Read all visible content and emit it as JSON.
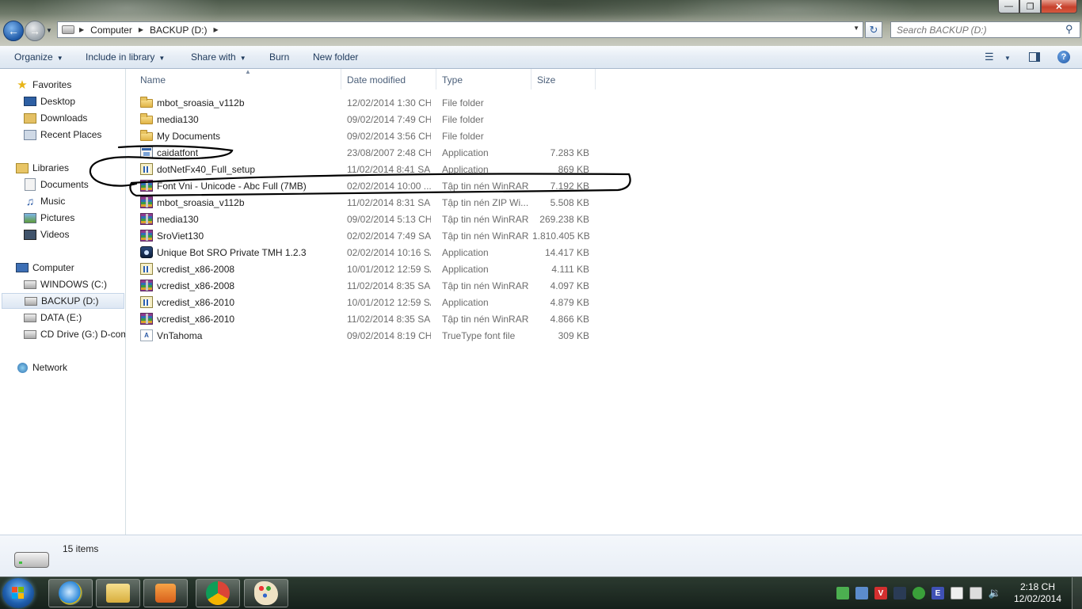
{
  "window": {
    "minimize_glyph": "—",
    "maximize_glyph": "❐",
    "close_glyph": "✕"
  },
  "address": {
    "crumbs": [
      "Computer",
      "BACKUP (D:)"
    ],
    "search_placeholder": "Search BACKUP (D:)"
  },
  "toolbar": {
    "organize": "Organize",
    "include_in_library": "Include in library",
    "share_with": "Share with",
    "burn": "Burn",
    "new_folder": "New folder"
  },
  "nav": {
    "favorites": "Favorites",
    "desktop": "Desktop",
    "downloads": "Downloads",
    "recent_places": "Recent Places",
    "libraries": "Libraries",
    "documents": "Documents",
    "music": "Music",
    "pictures": "Pictures",
    "videos": "Videos",
    "computer": "Computer",
    "windows_c": "WINDOWS (C:)",
    "backup_d": "BACKUP (D:)",
    "data_e": "DATA (E:)",
    "cd_drive": "CD Drive (G:) D-com",
    "network": "Network"
  },
  "columns": {
    "name": "Name",
    "date_modified": "Date modified",
    "type": "Type",
    "size": "Size"
  },
  "files": [
    {
      "name": "mbot_sroasia_v112b",
      "date": "12/02/2014 1:30 CH",
      "type": "File folder",
      "size": "",
      "icon": "folder-icon"
    },
    {
      "name": "media130",
      "date": "09/02/2014 7:49 CH",
      "type": "File folder",
      "size": "",
      "icon": "folder-icon"
    },
    {
      "name": "My Documents",
      "date": "09/02/2014 3:56 CH",
      "type": "File folder",
      "size": "",
      "icon": "folder-icon"
    },
    {
      "name": "caidatfont",
      "date": "23/08/2007 2:48 CH",
      "type": "Application",
      "size": "7.283 KB",
      "icon": "application-icon"
    },
    {
      "name": "dotNetFx40_Full_setup",
      "date": "11/02/2014 8:41 SA",
      "type": "Application",
      "size": "869 KB",
      "icon": "setup-icon"
    },
    {
      "name": "Font Vni - Unicode - Abc Full (7MB)",
      "date": "02/02/2014 10:00 ...",
      "type": "Tập tin nén WinRAR",
      "size": "7.192 KB",
      "icon": "winrar-archive-icon"
    },
    {
      "name": "mbot_sroasia_v112b",
      "date": "11/02/2014 8:31 SA",
      "type": "Tập tin nén ZIP Wi...",
      "size": "5.508 KB",
      "icon": "winrar-archive-icon"
    },
    {
      "name": "media130",
      "date": "09/02/2014 5:13 CH",
      "type": "Tập tin nén WinRAR",
      "size": "269.238 KB",
      "icon": "winrar-archive-icon"
    },
    {
      "name": "SroViet130",
      "date": "02/02/2014 7:49 SA",
      "type": "Tập tin nén WinRAR",
      "size": "1.810.405 KB",
      "icon": "winrar-archive-icon"
    },
    {
      "name": "Unique Bot SRO Private TMH 1.2.3",
      "date": "02/02/2014 10:16 SA",
      "type": "Application",
      "size": "14.417 KB",
      "icon": "bot-app-icon"
    },
    {
      "name": "vcredist_x86-2008",
      "date": "10/01/2012 12:59 SA",
      "type": "Application",
      "size": "4.111 KB",
      "icon": "setup-icon"
    },
    {
      "name": "vcredist_x86-2008",
      "date": "11/02/2014 8:35 SA",
      "type": "Tập tin nén WinRAR",
      "size": "4.097 KB",
      "icon": "winrar-archive-icon"
    },
    {
      "name": "vcredist_x86-2010",
      "date": "10/01/2012 12:59 SA",
      "type": "Application",
      "size": "4.879 KB",
      "icon": "setup-icon"
    },
    {
      "name": "vcredist_x86-2010",
      "date": "11/02/2014 8:35 SA",
      "type": "Tập tin nén WinRAR",
      "size": "4.866 KB",
      "icon": "winrar-archive-icon"
    },
    {
      "name": "VnTahoma",
      "date": "09/02/2014 8:19 CH",
      "type": "TrueType font file",
      "size": "309 KB",
      "icon": "font-file-icon"
    }
  ],
  "status": {
    "items_count": "15 items"
  },
  "taskbar": {
    "clock_time": "2:18 CH",
    "clock_date": "12/02/2014",
    "tray_v_label": "V",
    "tray_e_label": "E"
  }
}
